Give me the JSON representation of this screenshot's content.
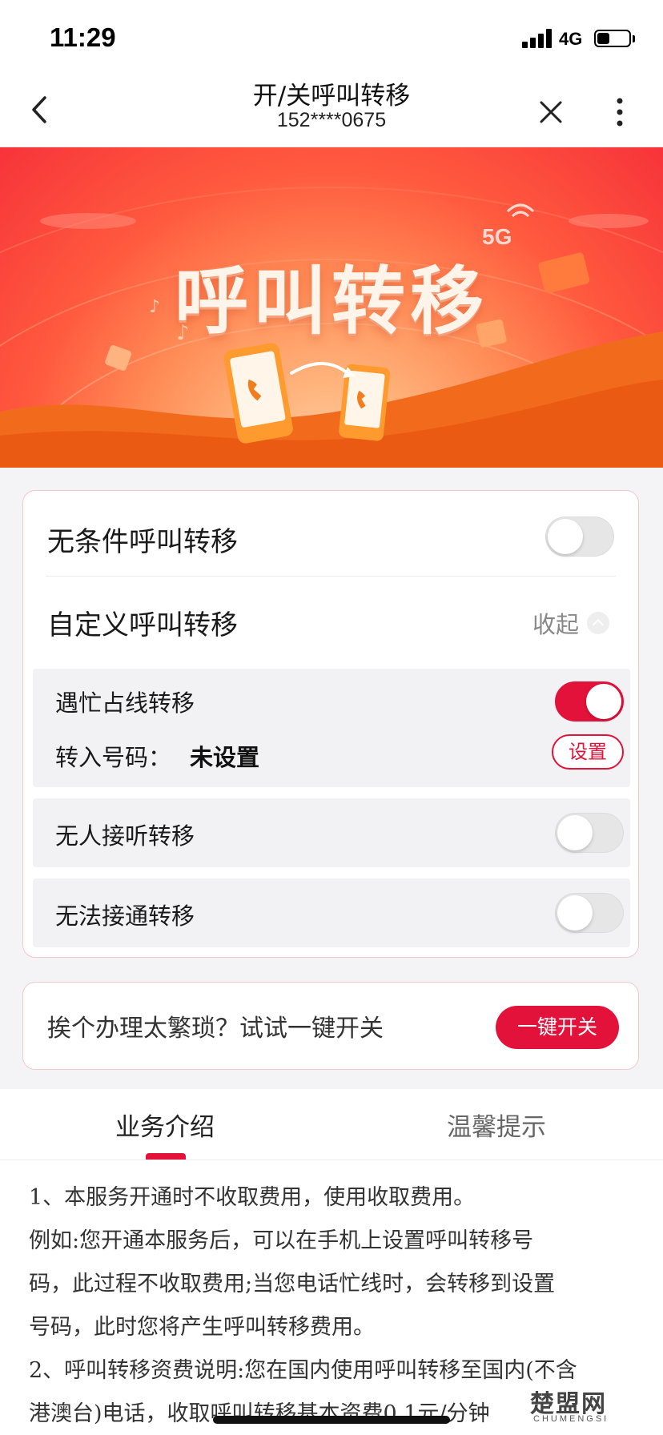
{
  "status_bar": {
    "time": "11:29",
    "network": "4G",
    "battery_level": 0.4
  },
  "nav": {
    "title": "开/关呼叫转移",
    "subtitle": "152****0675",
    "icons": {
      "back": "chevron-left-icon",
      "close": "close-icon",
      "more": "more-vertical-icon"
    }
  },
  "banner": {
    "title": "呼叫转移",
    "badge": "5G"
  },
  "forwarding": {
    "unconditional": {
      "label": "无条件呼叫转移",
      "enabled": false
    },
    "custom": {
      "label": "自定义呼叫转移",
      "collapse_label": "收起",
      "busy": {
        "label": "遇忙占线转移",
        "enabled": true,
        "number_key": "转入号码：",
        "number_value": "未设置",
        "set_label": "设置"
      },
      "no_answer": {
        "label": "无人接听转移",
        "enabled": false
      },
      "unreachable": {
        "label": "无法接通转移",
        "enabled": false
      }
    }
  },
  "quick": {
    "text": "挨个办理太繁琐？试试一键开关",
    "button": "一键开关"
  },
  "tabs": [
    {
      "label": "业务介绍",
      "active": true
    },
    {
      "label": "温馨提示",
      "active": false
    }
  ],
  "content": {
    "p1_l1": "1、本服务开通时不收取费用，使用收取费用。",
    "p1_l2": "例如:您开通本服务后，可以在手机上设置呼叫转移号",
    "p1_l3": "码，此过程不收取费用;当您电话忙线时，会转移到设置",
    "p1_l4": "号码，此时您将产生呼叫转移费用。",
    "p2_l1": "2、呼叫转移资费说明:您在国内使用呼叫转移至国内(不含",
    "p2_l2": "港澳台)电话，收取呼叫转移基本资费0.1元/分钟"
  },
  "watermark": {
    "brand": "楚盟网",
    "sub": "CHUMENGSI"
  },
  "colors": {
    "accent": "#e3123a",
    "banner_top": "#f7333a",
    "banner_bottom": "#ffd4ad"
  }
}
